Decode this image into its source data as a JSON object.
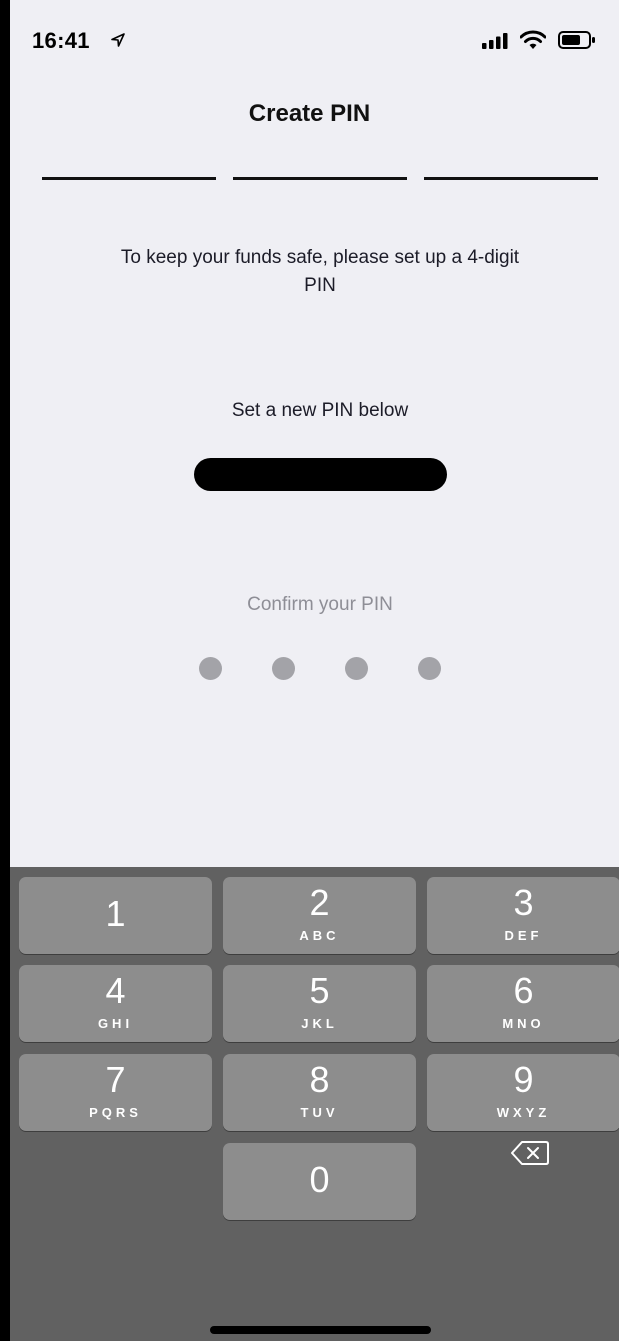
{
  "status_bar": {
    "time": "16:41",
    "icons": [
      "location-arrow-icon",
      "cellular-signal-icon",
      "wifi-icon",
      "battery-icon"
    ]
  },
  "header": {
    "title": "Create PIN",
    "progress_steps": 3
  },
  "intro_text": "To keep your funds safe, please set up a 4-digit PIN",
  "set_pin": {
    "label": "Set a new PIN below",
    "entered_digits": 4
  },
  "confirm_pin": {
    "label": "Confirm your PIN",
    "entered_digits": 0,
    "total_digits": 4
  },
  "keypad": {
    "keys": [
      {
        "digit": "1",
        "letters": ""
      },
      {
        "digit": "2",
        "letters": "ABC"
      },
      {
        "digit": "3",
        "letters": "DEF"
      },
      {
        "digit": "4",
        "letters": "GHI"
      },
      {
        "digit": "5",
        "letters": "JKL"
      },
      {
        "digit": "6",
        "letters": "MNO"
      },
      {
        "digit": "7",
        "letters": "PQRS"
      },
      {
        "digit": "8",
        "letters": "TUV"
      },
      {
        "digit": "9",
        "letters": "WXYZ"
      },
      {
        "digit": "0",
        "letters": ""
      }
    ],
    "delete_icon": "backspace-icon"
  },
  "colors": {
    "background": "#EFEFF4",
    "keypad_background": "#616161",
    "key_background": "#8D8D8D",
    "dot_inactive": "#A3A3A8",
    "text_muted": "#8E8E96"
  }
}
